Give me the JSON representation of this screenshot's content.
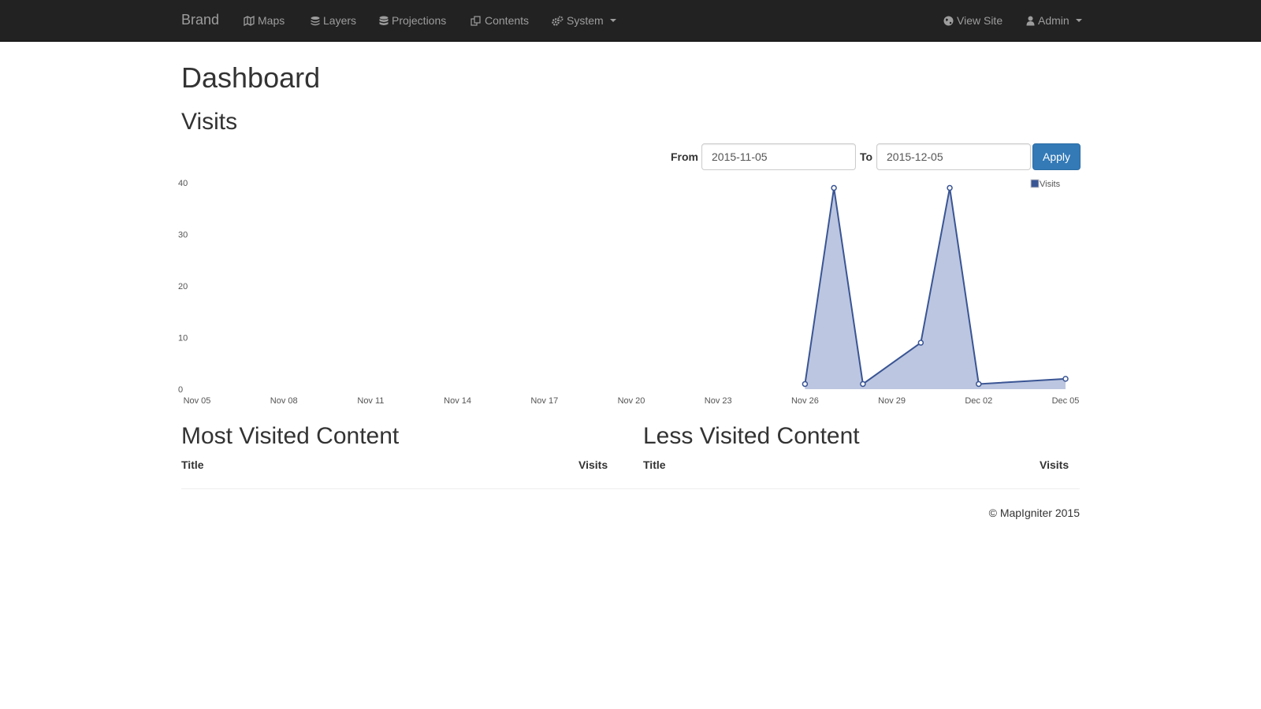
{
  "navbar": {
    "brand": "Brand",
    "items": [
      {
        "label": "Maps",
        "icon": "map-icon"
      },
      {
        "label": "Layers",
        "icon": "layers-icon"
      },
      {
        "label": "Projections",
        "icon": "database-icon"
      },
      {
        "label": "Contents",
        "icon": "files-icon"
      },
      {
        "label": "System",
        "icon": "cogs-icon"
      }
    ],
    "right": [
      {
        "label": "View Site",
        "icon": "globe-icon"
      },
      {
        "label": "Admin",
        "icon": "user-icon"
      }
    ]
  },
  "page_title": "Dashboard",
  "visits_section": {
    "title": "Visits",
    "from_label": "From",
    "from_value": "2015-11-05",
    "to_label": "To",
    "to_value": "2015-12-05",
    "apply_label": "Apply"
  },
  "chart_data": {
    "type": "area",
    "x": [
      "Nov 05",
      "Nov 06",
      "Nov 07",
      "Nov 08",
      "Nov 09",
      "Nov 10",
      "Nov 11",
      "Nov 12",
      "Nov 13",
      "Nov 14",
      "Nov 15",
      "Nov 16",
      "Nov 17",
      "Nov 18",
      "Nov 19",
      "Nov 20",
      "Nov 21",
      "Nov 22",
      "Nov 23",
      "Nov 24",
      "Nov 25",
      "Nov 26",
      "Nov 27",
      "Nov 28",
      "Nov 29",
      "Nov 30",
      "Dec 01",
      "Dec 02",
      "Dec 03",
      "Dec 04",
      "Dec 05"
    ],
    "x_ticks": [
      "Nov 05",
      "Nov 08",
      "Nov 11",
      "Nov 14",
      "Nov 17",
      "Nov 20",
      "Nov 23",
      "Nov 26",
      "Nov 29",
      "Dec 02",
      "Dec 05"
    ],
    "series": [
      {
        "name": "Visits",
        "points": [
          {
            "x": "Nov 26",
            "y": 1
          },
          {
            "x": "Nov 27",
            "y": 39
          },
          {
            "x": "Nov 28",
            "y": 1
          },
          {
            "x": "Nov 30",
            "y": 9
          },
          {
            "x": "Dec 01",
            "y": 39
          },
          {
            "x": "Dec 02",
            "y": 1
          },
          {
            "x": "Dec 05",
            "y": 2
          }
        ]
      }
    ],
    "yticks": [
      0,
      10,
      20,
      30,
      40
    ],
    "ylim": [
      0,
      40
    ],
    "legend": "top-right",
    "colors": {
      "line": "#3a5594",
      "fill": "#a6b3d6",
      "legend": "#3a5594"
    }
  },
  "most_visited": {
    "title": "Most Visited Content",
    "col_title": "Title",
    "col_visits": "Visits"
  },
  "less_visited": {
    "title": "Less Visited Content",
    "col_title": "Title",
    "col_visits": "Visits"
  },
  "footer": "© MapIgniter 2015"
}
